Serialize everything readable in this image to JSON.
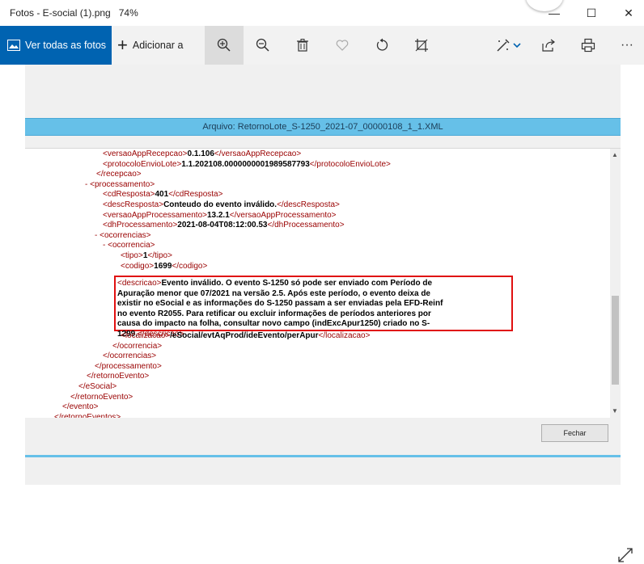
{
  "window": {
    "title": "Fotos - E-social (1).png",
    "zoom": "74%",
    "controls": {
      "minimize": "—",
      "maximize": "☐",
      "close": "✕"
    }
  },
  "toolbar": {
    "see_all_label": "Ver todas as fotos",
    "add_label": "Adicionar a",
    "icons": [
      "zoom-in-icon",
      "zoom-out-icon",
      "delete-icon",
      "favorite-icon",
      "rotate-icon",
      "crop-icon",
      "edit-icon",
      "share-icon",
      "print-icon",
      "more-icon"
    ],
    "more_label": "···"
  },
  "document": {
    "file_header": "Arquivo: RetornoLote_S-1250_2021-07_00000108_1_1.XML",
    "close_button": "Fechar",
    "xml_lines": [
      {
        "indent": 96,
        "pre": "<",
        "tag": "versaoAppRecepcao",
        "value": "0.1.106",
        "close": "</versaoAppRecepcao>"
      },
      {
        "indent": 96,
        "pre": "<",
        "tag": "protocoloEnvioLote",
        "value": "1.1.202108.0000000001989587793",
        "close": "</protocoloEnvioLote>"
      },
      {
        "indent": 88,
        "pre": "</",
        "tag": "recepcao",
        "value": "",
        "close": ""
      },
      {
        "indent": 74,
        "pre": "- <",
        "tag": "processamento",
        "value": "",
        "close": ""
      },
      {
        "indent": 96,
        "pre": "<",
        "tag": "cdResposta",
        "value": "401",
        "close": "</cdResposta>"
      },
      {
        "indent": 96,
        "pre": "<",
        "tag": "descResposta",
        "value": "Conteudo do evento inválido.",
        "close": "</descResposta>"
      },
      {
        "indent": 96,
        "pre": "<",
        "tag": "versaoAppProcessamento",
        "value": "13.2.1",
        "close": "</versaoAppProcessamento>"
      },
      {
        "indent": 96,
        "pre": "<",
        "tag": "dhProcessamento",
        "value": "2021-08-04T08:12:00.53",
        "close": "</dhProcessamento>"
      },
      {
        "indent": 86,
        "pre": "- <",
        "tag": "ocorrencias",
        "value": "",
        "close": ""
      },
      {
        "indent": 96,
        "pre": "- <",
        "tag": "ocorrencia",
        "value": "",
        "close": ""
      },
      {
        "indent": 118,
        "pre": "<",
        "tag": "tipo",
        "value": "1",
        "close": "</tipo>"
      },
      {
        "indent": 118,
        "pre": "<",
        "tag": "codigo",
        "value": "1699",
        "close": "</codigo>"
      }
    ],
    "descricao_open": "<descricao>",
    "descricao_text_lines": [
      "Evento inválido. O evento S-1250 só pode ser enviado com Período de",
      "Apuração menor que 07/2021 na versão 2.5. Após este período, o evento deixa de",
      "existir no eSocial e as informações do S-1250 passam a ser enviadas pela EFD-Reinf",
      "no evento R2055. Para retificar ou excluir informações de períodos anteriores por",
      "causa do impacto na folha, consultar novo campo (indExcApur1250) criado no S-",
      "1299."
    ],
    "descricao_close": "</descricao>",
    "xml_tail": [
      {
        "indent": 118,
        "pre": "<",
        "tag": "localizacao",
        "value": "/eSocial/evtAqProd/ideEvento/perApur",
        "close": "</localizacao>"
      },
      {
        "indent": 108,
        "pre": "</",
        "tag": "ocorrencia",
        "value": "",
        "close": ""
      },
      {
        "indent": 96,
        "pre": "</",
        "tag": "ocorrencias",
        "value": "",
        "close": ""
      },
      {
        "indent": 86,
        "pre": "</",
        "tag": "processamento",
        "value": "",
        "close": ""
      },
      {
        "indent": 76,
        "pre": "</",
        "tag": "retornoEvento",
        "value": "",
        "close": ""
      },
      {
        "indent": 66,
        "pre": "</",
        "tag": "eSocial",
        "value": "",
        "close": ""
      },
      {
        "indent": 56,
        "pre": "</",
        "tag": "retornoEvento",
        "value": "",
        "close": ""
      },
      {
        "indent": 46,
        "pre": "</",
        "tag": "evento",
        "value": "",
        "close": ""
      },
      {
        "indent": 36,
        "pre": "</",
        "tag": "retornoEventos",
        "value": "",
        "close": ""
      }
    ]
  },
  "colors": {
    "accent": "#0063b1",
    "header_strip": "#66c0e8",
    "xml_tag": "#990000",
    "highlight_box": "#e01010"
  }
}
